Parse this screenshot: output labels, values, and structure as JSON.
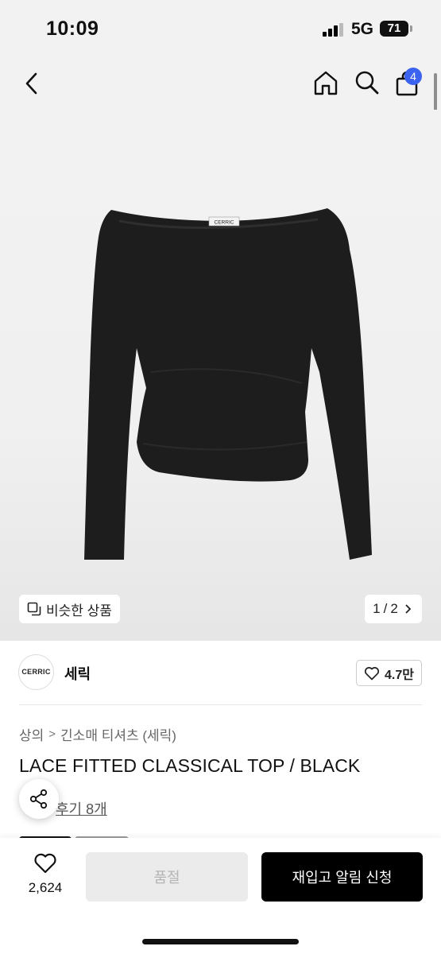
{
  "status_bar": {
    "time": "10:09",
    "network": "5G",
    "battery": "71"
  },
  "header": {
    "cart_count": "4",
    "icons": [
      "back-arrow-icon",
      "home-icon",
      "search-icon",
      "shopping-bag-icon"
    ]
  },
  "gallery": {
    "similar_label": "비슷한 상품",
    "page_current": "1",
    "page_sep": "/",
    "page_total": "2",
    "garment_label": "CERRIC"
  },
  "brand": {
    "logo_text": "CERRIC",
    "name": "세릭",
    "likes": "4.7만"
  },
  "breadcrumb": {
    "level1": "상의",
    "level2": "긴소매 티셔츠 (세릭)"
  },
  "product": {
    "title": "LACE FITTED CLASSICAL TOP / BLACK",
    "reviews_label": "후기 8개"
  },
  "bottom_bar": {
    "wish_count": "2,624",
    "soldout_label": "품절",
    "restock_label": "재입고 알림 신청"
  },
  "colors": {
    "accent_badge": "#3b63f0",
    "primary_button": "#000000",
    "disabled_button": "#ebebeb"
  }
}
